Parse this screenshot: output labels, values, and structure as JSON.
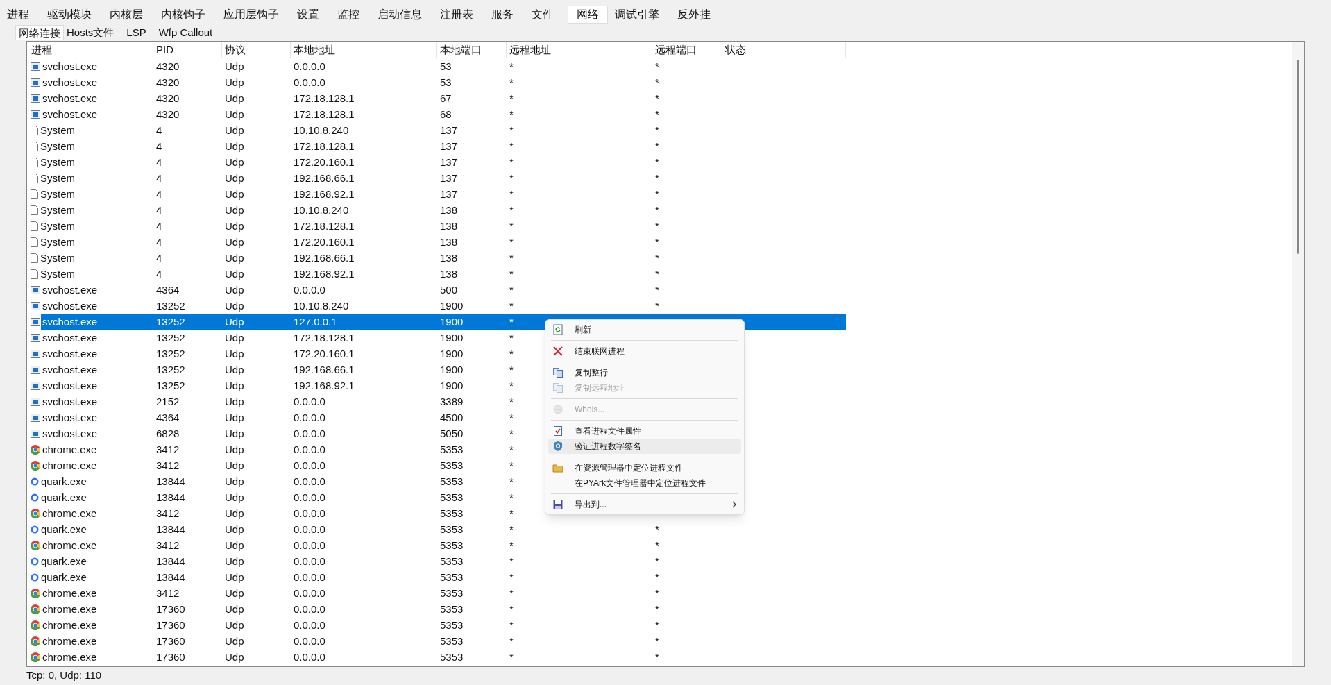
{
  "tabs": [
    {
      "label": "进程",
      "selected": false
    },
    {
      "label": "驱动模块",
      "selected": false
    },
    {
      "label": "内核层",
      "selected": false
    },
    {
      "label": "内核钩子",
      "selected": false
    },
    {
      "label": "应用层钩子",
      "selected": false
    },
    {
      "label": "设置",
      "selected": false
    },
    {
      "label": "监控",
      "selected": false
    },
    {
      "label": "启动信息",
      "selected": false
    },
    {
      "label": "注册表",
      "selected": false
    },
    {
      "label": "服务",
      "selected": false
    },
    {
      "label": "文件",
      "selected": false
    },
    {
      "label": "网络",
      "selected": true
    },
    {
      "label": "调试引擎",
      "selected": false
    },
    {
      "label": "反外挂",
      "selected": false
    }
  ],
  "subtabs": [
    {
      "label": "网络连接",
      "selected": true
    },
    {
      "label": "Hosts文件",
      "selected": false
    },
    {
      "label": "LSP",
      "selected": false
    },
    {
      "label": "Wfp Callout",
      "selected": false
    }
  ],
  "table": {
    "columns": [
      "进程",
      "PID",
      "协议",
      "本地地址",
      "本地端口",
      "远程地址",
      "远程端口",
      "状态"
    ],
    "rows": [
      {
        "kind": "service",
        "process": "svchost.exe",
        "pid": "4320",
        "protocol": "Udp",
        "local_address": "0.0.0.0",
        "local_port": "53",
        "remote_address": "*",
        "remote_port": "*",
        "selected": false
      },
      {
        "kind": "service",
        "process": "svchost.exe",
        "pid": "4320",
        "protocol": "Udp",
        "local_address": "0.0.0.0",
        "local_port": "53",
        "remote_address": "*",
        "remote_port": "*",
        "selected": false
      },
      {
        "kind": "service",
        "process": "svchost.exe",
        "pid": "4320",
        "protocol": "Udp",
        "local_address": "172.18.128.1",
        "local_port": "67",
        "remote_address": "*",
        "remote_port": "*",
        "selected": false
      },
      {
        "kind": "service",
        "process": "svchost.exe",
        "pid": "4320",
        "protocol": "Udp",
        "local_address": "172.18.128.1",
        "local_port": "68",
        "remote_address": "*",
        "remote_port": "*",
        "selected": false
      },
      {
        "kind": "file",
        "process": "System",
        "pid": "4",
        "protocol": "Udp",
        "local_address": "10.10.8.240",
        "local_port": "137",
        "remote_address": "*",
        "remote_port": "*",
        "selected": false
      },
      {
        "kind": "file",
        "process": "System",
        "pid": "4",
        "protocol": "Udp",
        "local_address": "172.18.128.1",
        "local_port": "137",
        "remote_address": "*",
        "remote_port": "*",
        "selected": false
      },
      {
        "kind": "file",
        "process": "System",
        "pid": "4",
        "protocol": "Udp",
        "local_address": "172.20.160.1",
        "local_port": "137",
        "remote_address": "*",
        "remote_port": "*",
        "selected": false
      },
      {
        "kind": "file",
        "process": "System",
        "pid": "4",
        "protocol": "Udp",
        "local_address": "192.168.66.1",
        "local_port": "137",
        "remote_address": "*",
        "remote_port": "*",
        "selected": false
      },
      {
        "kind": "file",
        "process": "System",
        "pid": "4",
        "protocol": "Udp",
        "local_address": "192.168.92.1",
        "local_port": "137",
        "remote_address": "*",
        "remote_port": "*",
        "selected": false
      },
      {
        "kind": "file",
        "process": "System",
        "pid": "4",
        "protocol": "Udp",
        "local_address": "10.10.8.240",
        "local_port": "138",
        "remote_address": "*",
        "remote_port": "*",
        "selected": false
      },
      {
        "kind": "file",
        "process": "System",
        "pid": "4",
        "protocol": "Udp",
        "local_address": "172.18.128.1",
        "local_port": "138",
        "remote_address": "*",
        "remote_port": "*",
        "selected": false
      },
      {
        "kind": "file",
        "process": "System",
        "pid": "4",
        "protocol": "Udp",
        "local_address": "172.20.160.1",
        "local_port": "138",
        "remote_address": "*",
        "remote_port": "*",
        "selected": false
      },
      {
        "kind": "file",
        "process": "System",
        "pid": "4",
        "protocol": "Udp",
        "local_address": "192.168.66.1",
        "local_port": "138",
        "remote_address": "*",
        "remote_port": "*",
        "selected": false
      },
      {
        "kind": "file",
        "process": "System",
        "pid": "4",
        "protocol": "Udp",
        "local_address": "192.168.92.1",
        "local_port": "138",
        "remote_address": "*",
        "remote_port": "*",
        "selected": false
      },
      {
        "kind": "service",
        "process": "svchost.exe",
        "pid": "4364",
        "protocol": "Udp",
        "local_address": "0.0.0.0",
        "local_port": "500",
        "remote_address": "*",
        "remote_port": "*",
        "selected": false
      },
      {
        "kind": "service",
        "process": "svchost.exe",
        "pid": "13252",
        "protocol": "Udp",
        "local_address": "10.10.8.240",
        "local_port": "1900",
        "remote_address": "*",
        "remote_port": "*",
        "selected": false
      },
      {
        "kind": "service",
        "process": "svchost.exe",
        "pid": "13252",
        "protocol": "Udp",
        "local_address": "127.0.0.1",
        "local_port": "1900",
        "remote_address": "*",
        "selected": true
      },
      {
        "kind": "service",
        "process": "svchost.exe",
        "pid": "13252",
        "protocol": "Udp",
        "local_address": "172.18.128.1",
        "local_port": "1900",
        "remote_address": "*",
        "selected": false
      },
      {
        "kind": "service",
        "process": "svchost.exe",
        "pid": "13252",
        "protocol": "Udp",
        "local_address": "172.20.160.1",
        "local_port": "1900",
        "remote_address": "*",
        "selected": false
      },
      {
        "kind": "service",
        "process": "svchost.exe",
        "pid": "13252",
        "protocol": "Udp",
        "local_address": "192.168.66.1",
        "local_port": "1900",
        "remote_address": "*",
        "selected": false
      },
      {
        "kind": "service",
        "process": "svchost.exe",
        "pid": "13252",
        "protocol": "Udp",
        "local_address": "192.168.92.1",
        "local_port": "1900",
        "remote_address": "*",
        "selected": false
      },
      {
        "kind": "service",
        "process": "svchost.exe",
        "pid": "2152",
        "protocol": "Udp",
        "local_address": "0.0.0.0",
        "local_port": "3389",
        "remote_address": "*",
        "selected": false
      },
      {
        "kind": "service",
        "process": "svchost.exe",
        "pid": "4364",
        "protocol": "Udp",
        "local_address": "0.0.0.0",
        "local_port": "4500",
        "remote_address": "*",
        "selected": false
      },
      {
        "kind": "service",
        "process": "svchost.exe",
        "pid": "6828",
        "protocol": "Udp",
        "local_address": "0.0.0.0",
        "local_port": "5050",
        "remote_address": "*",
        "selected": false
      },
      {
        "kind": "chrome",
        "process": "chrome.exe",
        "pid": "3412",
        "protocol": "Udp",
        "local_address": "0.0.0.0",
        "local_port": "5353",
        "remote_address": "*",
        "selected": false
      },
      {
        "kind": "chrome",
        "process": "chrome.exe",
        "pid": "3412",
        "protocol": "Udp",
        "local_address": "0.0.0.0",
        "local_port": "5353",
        "remote_address": "*",
        "selected": false
      },
      {
        "kind": "quark",
        "process": "quark.exe",
        "pid": "13844",
        "protocol": "Udp",
        "local_address": "0.0.0.0",
        "local_port": "5353",
        "remote_address": "*",
        "selected": false
      },
      {
        "kind": "quark",
        "process": "quark.exe",
        "pid": "13844",
        "protocol": "Udp",
        "local_address": "0.0.0.0",
        "local_port": "5353",
        "remote_address": "*",
        "selected": false
      },
      {
        "kind": "chrome",
        "process": "chrome.exe",
        "pid": "3412",
        "protocol": "Udp",
        "local_address": "0.0.0.0",
        "local_port": "5353",
        "remote_address": "*",
        "selected": false
      },
      {
        "kind": "quark",
        "process": "quark.exe",
        "pid": "13844",
        "protocol": "Udp",
        "local_address": "0.0.0.0",
        "local_port": "5353",
        "remote_address": "*",
        "remote_port": "*",
        "selected": false
      },
      {
        "kind": "chrome",
        "process": "chrome.exe",
        "pid": "3412",
        "protocol": "Udp",
        "local_address": "0.0.0.0",
        "local_port": "5353",
        "remote_address": "*",
        "remote_port": "*",
        "selected": false
      },
      {
        "kind": "quark",
        "process": "quark.exe",
        "pid": "13844",
        "protocol": "Udp",
        "local_address": "0.0.0.0",
        "local_port": "5353",
        "remote_address": "*",
        "remote_port": "*",
        "selected": false
      },
      {
        "kind": "quark",
        "process": "quark.exe",
        "pid": "13844",
        "protocol": "Udp",
        "local_address": "0.0.0.0",
        "local_port": "5353",
        "remote_address": "*",
        "remote_port": "*",
        "selected": false
      },
      {
        "kind": "chrome",
        "process": "chrome.exe",
        "pid": "3412",
        "protocol": "Udp",
        "local_address": "0.0.0.0",
        "local_port": "5353",
        "remote_address": "*",
        "remote_port": "*",
        "selected": false
      },
      {
        "kind": "chrome",
        "process": "chrome.exe",
        "pid": "17360",
        "protocol": "Udp",
        "local_address": "0.0.0.0",
        "local_port": "5353",
        "remote_address": "*",
        "remote_port": "*",
        "selected": false
      },
      {
        "kind": "chrome",
        "process": "chrome.exe",
        "pid": "17360",
        "protocol": "Udp",
        "local_address": "0.0.0.0",
        "local_port": "5353",
        "remote_address": "*",
        "remote_port": "*",
        "selected": false
      },
      {
        "kind": "chrome",
        "process": "chrome.exe",
        "pid": "17360",
        "protocol": "Udp",
        "local_address": "0.0.0.0",
        "local_port": "5353",
        "remote_address": "*",
        "remote_port": "*",
        "selected": false
      },
      {
        "kind": "chrome",
        "process": "chrome.exe",
        "pid": "17360",
        "protocol": "Udp",
        "local_address": "0.0.0.0",
        "local_port": "5353",
        "remote_address": "*",
        "remote_port": "*",
        "selected": false
      }
    ]
  },
  "context_menu": [
    {
      "kind": "refresh",
      "label": "刷新",
      "disabled": false,
      "highlighted": false
    },
    {
      "kind": "separator"
    },
    {
      "kind": "terminate",
      "label": "结束联网进程",
      "disabled": false,
      "highlighted": false
    },
    {
      "kind": "separator"
    },
    {
      "kind": "copy",
      "label": "复制整行",
      "disabled": false,
      "highlighted": false
    },
    {
      "kind": "copy",
      "label": "复制远程地址",
      "disabled": true,
      "highlighted": false
    },
    {
      "kind": "separator"
    },
    {
      "kind": "whois",
      "label": "Whois...",
      "disabled": true,
      "highlighted": false
    },
    {
      "kind": "separator"
    },
    {
      "kind": "properties",
      "label": "查看进程文件属性",
      "disabled": false,
      "highlighted": false
    },
    {
      "kind": "signature",
      "label": "验证进程数字签名",
      "disabled": false,
      "highlighted": true
    },
    {
      "kind": "separator"
    },
    {
      "kind": "locate",
      "label": "在资源管理器中定位进程文件",
      "disabled": false,
      "highlighted": false
    },
    {
      "kind": "text",
      "label": "在PYArk文件管理器中定位进程文件",
      "disabled": false,
      "highlighted": false
    },
    {
      "kind": "separator"
    },
    {
      "kind": "export",
      "label": "导出到...",
      "disabled": false,
      "highlighted": false,
      "submenu": true
    }
  ],
  "status_bar": "Tcp: 0, Udp: 110"
}
